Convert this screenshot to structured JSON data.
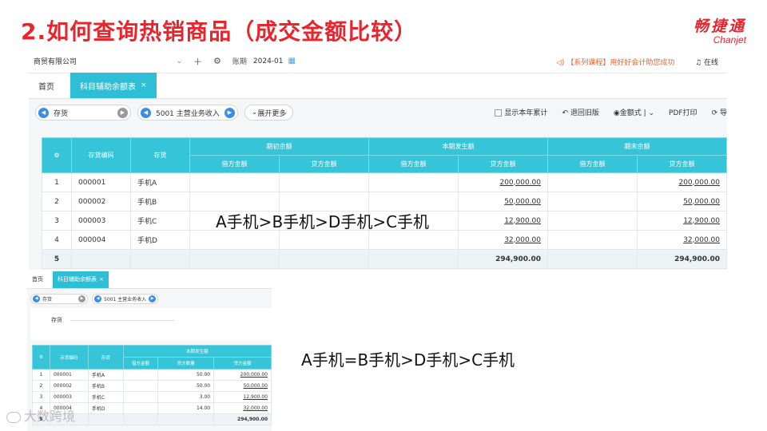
{
  "slide": {
    "title": "2.如何查询热销商品（成交金额比较）",
    "logo_cn": "畅捷通",
    "logo_en": "Chanjet"
  },
  "app": {
    "company": "商贸有限公司",
    "period_label": "账期",
    "period": "2024-01",
    "notice": "【系列课程】用好好会计助您成功",
    "online": "在线",
    "tabs": [
      "首页",
      "科目辅助余额表"
    ],
    "filters": {
      "dimension": "存货",
      "account": "5001 主营业务收入",
      "more": "展开更多"
    },
    "tools": {
      "show_year": "显示本年累计",
      "back_old": "退回旧版",
      "amount_style": "金额式",
      "pdf_print": "PDF打印",
      "export": "导"
    }
  },
  "table1": {
    "group_headers": [
      "期初余额",
      "本期发生额",
      "期末余额"
    ],
    "headers": [
      "存货编码",
      "存货"
    ],
    "sub_headers": [
      "借方金额",
      "贷方金额",
      "借方金额",
      "贷方金额",
      "借方金额",
      "贷方金额"
    ],
    "rows": [
      {
        "idx": "1",
        "code": "000001",
        "name": "手机A",
        "credit": "200,000.00",
        "end": "200,000.00"
      },
      {
        "idx": "2",
        "code": "000002",
        "name": "手机B",
        "credit": "50,000.00",
        "end": "50,000.00"
      },
      {
        "idx": "3",
        "code": "000003",
        "name": "手机C",
        "credit": "12,900.00",
        "end": "12,900.00"
      },
      {
        "idx": "4",
        "code": "000004",
        "name": "手机D",
        "credit": "32,000.00",
        "end": "32,000.00"
      }
    ],
    "total": {
      "idx": "5",
      "credit": "294,900.00",
      "end": "294,900.00"
    }
  },
  "shot2": {
    "tabs": [
      "首页",
      "科目辅助余额表"
    ],
    "filter_dimension": "存货",
    "filter_account": "5001 主营业务收入",
    "panel_label": "存货",
    "group_header": "本期发生额",
    "headers": [
      "存货编码",
      "存货"
    ],
    "sub_headers": [
      "借方金额",
      "贷方数量",
      "贷方金额"
    ],
    "rows": [
      {
        "idx": "1",
        "code": "000001",
        "name": "手机A",
        "qty": "50.00",
        "amount": "200,000.00"
      },
      {
        "idx": "2",
        "code": "000002",
        "name": "手机B",
        "qty": "50.00",
        "amount": "50,000.00"
      },
      {
        "idx": "3",
        "code": "000003",
        "name": "手机C",
        "qty": "3.00",
        "amount": "12,900.00"
      },
      {
        "idx": "4",
        "code": "000004",
        "name": "手机D",
        "qty": "14.00",
        "amount": "32,000.00"
      }
    ],
    "total": {
      "idx": "5",
      "amount": "294,900.00"
    }
  },
  "annotations": {
    "first": "A手机>B手机>D手机>C手机",
    "second": "A手机=B手机>D手机>C手机"
  },
  "watermark": "大数跨境"
}
